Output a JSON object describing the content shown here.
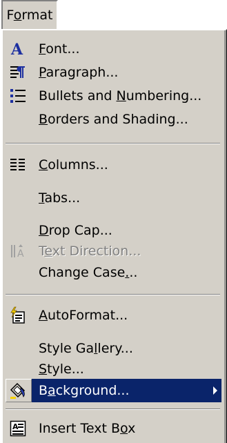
{
  "menubar": {
    "title": "Format",
    "mnemonic_index": 1
  },
  "menu": {
    "items": [
      {
        "label": "Font...",
        "u": 0,
        "icon": "font-a-icon"
      },
      {
        "label": "Paragraph...",
        "u": 0,
        "icon": "paragraph-icon"
      },
      {
        "label": "Bullets and Numbering...",
        "u": 12,
        "icon": "bullets-icon"
      },
      {
        "label": "Borders and Shading...",
        "u": 0,
        "icon": ""
      },
      {
        "label": "Columns...",
        "u": 0,
        "icon": "columns-icon"
      },
      {
        "label": "Tabs...",
        "u": 0,
        "icon": ""
      },
      {
        "label": "Drop Cap...",
        "u": 0,
        "icon": ""
      },
      {
        "label": "Text Direction...",
        "u": 1,
        "icon": "text-direction-icon",
        "disabled": true
      },
      {
        "label": "Change Case...",
        "u": 11,
        "icon": ""
      },
      {
        "label": "AutoFormat...",
        "u": 0,
        "icon": "autoformat-icon"
      },
      {
        "label": "Style Gallery...",
        "u": 8,
        "icon": ""
      },
      {
        "label": "Style...",
        "u": 0,
        "icon": ""
      },
      {
        "label": "Background...",
        "u": 1,
        "icon": "background-icon",
        "selected": true,
        "submenu": true
      },
      {
        "label": "Insert Text Box",
        "u": 13,
        "icon": "text-box-icon"
      }
    ]
  },
  "colors": {
    "menu_bg": "#d4d0c8",
    "selection": "#0a246a",
    "icon_blue": "#1c2fa0"
  }
}
